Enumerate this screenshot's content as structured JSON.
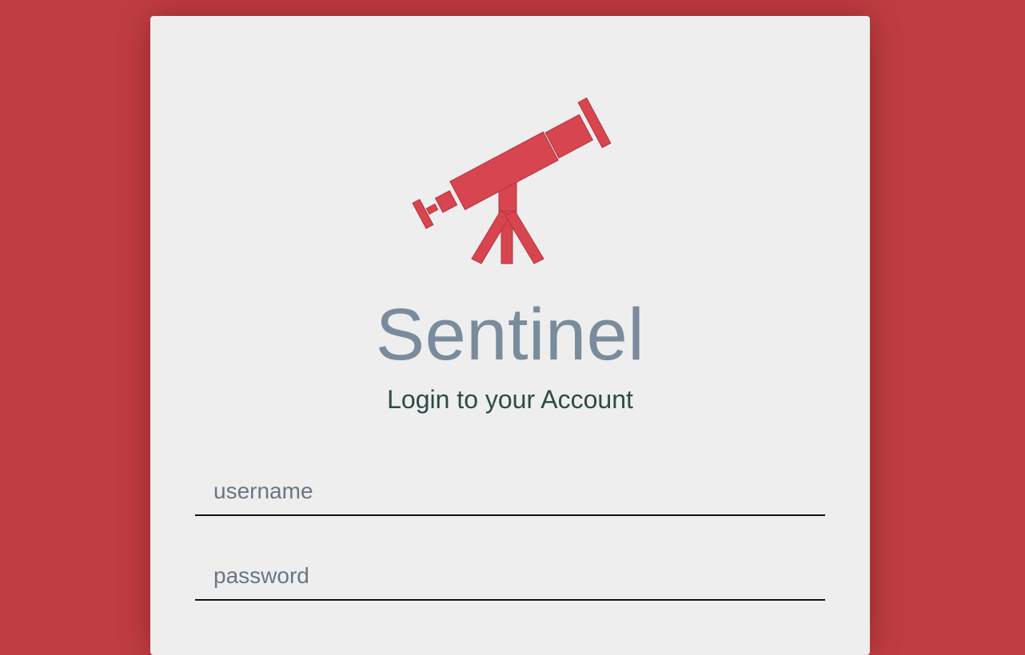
{
  "app": {
    "title": "Sentinel",
    "subtitle": "Login to your Account",
    "logo_icon": "telescope-icon"
  },
  "form": {
    "username": {
      "value": "",
      "placeholder": "username"
    },
    "password": {
      "value": "",
      "placeholder": "password"
    }
  },
  "colors": {
    "background": "#c03d42",
    "card": "#eeeeee",
    "logo": "#d64550",
    "title": "#7a8b9c",
    "subtitle": "#2f4a46"
  }
}
